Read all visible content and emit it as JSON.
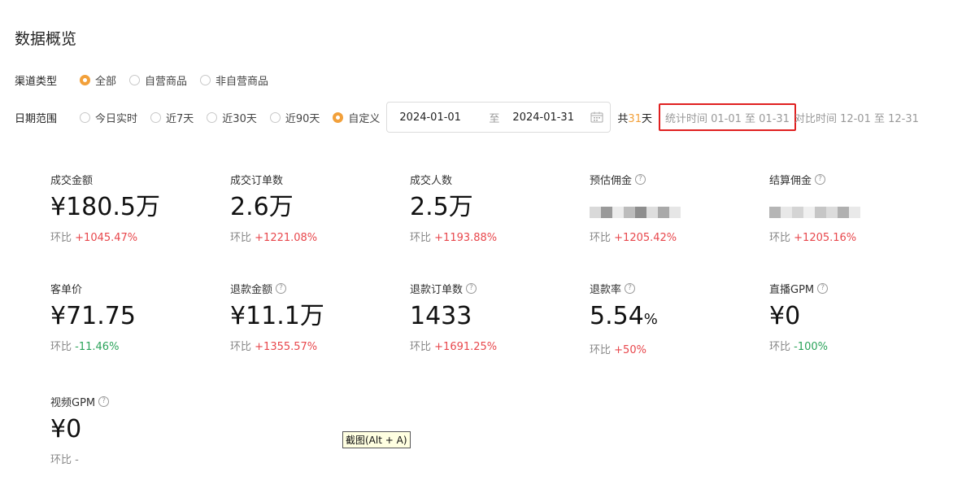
{
  "page": {
    "title": "数据概览"
  },
  "channel": {
    "label": "渠道类型",
    "options": [
      {
        "label": "全部",
        "checked": true
      },
      {
        "label": "自营商品",
        "checked": false
      },
      {
        "label": "非自营商品",
        "checked": false
      }
    ]
  },
  "date_range": {
    "label": "日期范围",
    "options": [
      {
        "label": "今日实时",
        "checked": false
      },
      {
        "label": "近7天",
        "checked": false
      },
      {
        "label": "近30天",
        "checked": false
      },
      {
        "label": "近90天",
        "checked": false
      },
      {
        "label": "自定义",
        "checked": true
      }
    ],
    "start": "2024-01-01",
    "separator": "至",
    "end": "2024-01-31",
    "total_prefix": "共",
    "total_days": "31",
    "total_suffix": "天",
    "stat_time": "统计时间 01-01 至 01-31",
    "compare_time": "对比时间 12-01 至 12-31"
  },
  "metrics": [
    {
      "label": "成交金额",
      "help": false,
      "value": "¥180.5万",
      "unit": "",
      "compare_label": "环比",
      "compare": "+1045.47%",
      "trend": "up"
    },
    {
      "label": "成交订单数",
      "help": false,
      "value": "2.6万",
      "unit": "",
      "compare_label": "环比",
      "compare": "+1221.08%",
      "trend": "up"
    },
    {
      "label": "成交人数",
      "help": false,
      "value": "2.5万",
      "unit": "",
      "compare_label": "环比",
      "compare": "+1193.88%",
      "trend": "up"
    },
    {
      "label": "预估佣金",
      "help": true,
      "value": "",
      "unit": "",
      "blurred": true,
      "compare_label": "环比",
      "compare": "+1205.42%",
      "trend": "up"
    },
    {
      "label": "结算佣金",
      "help": true,
      "value": "",
      "unit": "",
      "blurred": true,
      "compare_label": "环比",
      "compare": "+1205.16%",
      "trend": "up"
    },
    {
      "label": "客单价",
      "help": false,
      "value": "¥71.75",
      "unit": "",
      "compare_label": "环比",
      "compare": "-11.46%",
      "trend": "down"
    },
    {
      "label": "退款金额",
      "help": true,
      "value": "¥11.1万",
      "unit": "",
      "compare_label": "环比",
      "compare": "+1355.57%",
      "trend": "up"
    },
    {
      "label": "退款订单数",
      "help": true,
      "value": "1433",
      "unit": "",
      "compare_label": "环比",
      "compare": "+1691.25%",
      "trend": "up"
    },
    {
      "label": "退款率",
      "help": true,
      "value": "5.54",
      "unit": "%",
      "compare_label": "环比",
      "compare": "+50%",
      "trend": "up"
    },
    {
      "label": "直播GPM",
      "help": true,
      "value": "¥0",
      "unit": "",
      "compare_label": "环比",
      "compare": "-100%",
      "trend": "down"
    },
    {
      "label": "视频GPM",
      "help": true,
      "value": "¥0",
      "unit": "",
      "compare_label": "环比",
      "compare": "-",
      "trend": "none"
    }
  ],
  "help_glyph": "?",
  "tooltip": "截图(Alt + A)",
  "colors": {
    "accent": "#f2a03a",
    "up": "#e8474c",
    "down": "#2ba35a",
    "highlight_border": "#e02020"
  }
}
